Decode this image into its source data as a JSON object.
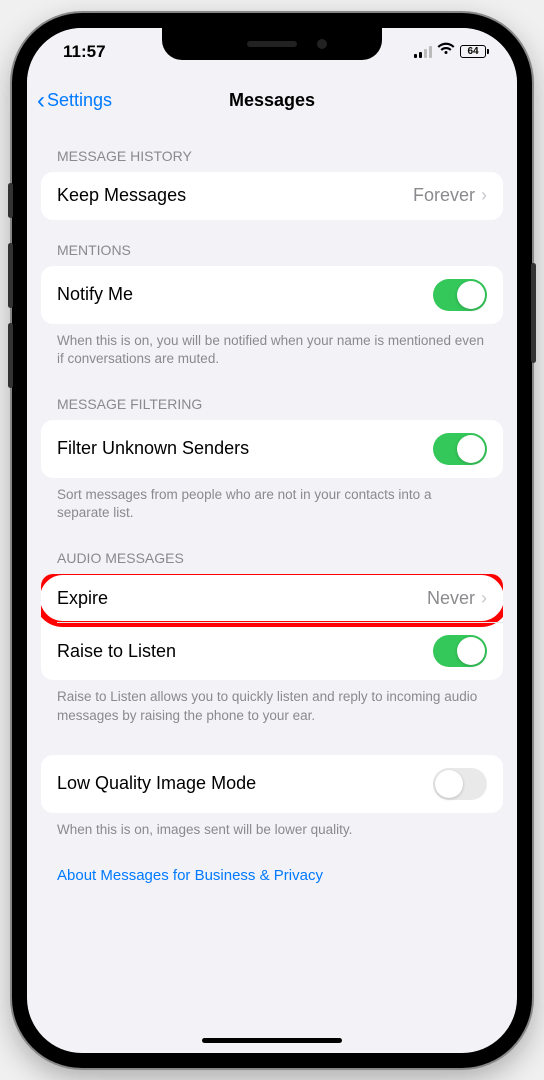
{
  "status": {
    "time": "11:57",
    "battery": "64"
  },
  "nav": {
    "back": "Settings",
    "title": "Messages"
  },
  "sections": {
    "message_history": {
      "header": "MESSAGE HISTORY",
      "keep_label": "Keep Messages",
      "keep_value": "Forever"
    },
    "mentions": {
      "header": "MENTIONS",
      "notify_label": "Notify Me",
      "footnote": "When this is on, you will be notified when your name is mentioned even if conversations are muted."
    },
    "filtering": {
      "header": "MESSAGE FILTERING",
      "filter_label": "Filter Unknown Senders",
      "footnote": "Sort messages from people who are not in your contacts into a separate list."
    },
    "audio": {
      "header": "AUDIO MESSAGES",
      "expire_label": "Expire",
      "expire_value": "Never",
      "raise_label": "Raise to Listen",
      "footnote": "Raise to Listen allows you to quickly listen and reply to incoming audio messages by raising the phone to your ear."
    },
    "low_quality": {
      "label": "Low Quality Image Mode",
      "footnote": "When this is on, images sent will be lower quality."
    },
    "about_link": "About Messages for Business & Privacy"
  }
}
